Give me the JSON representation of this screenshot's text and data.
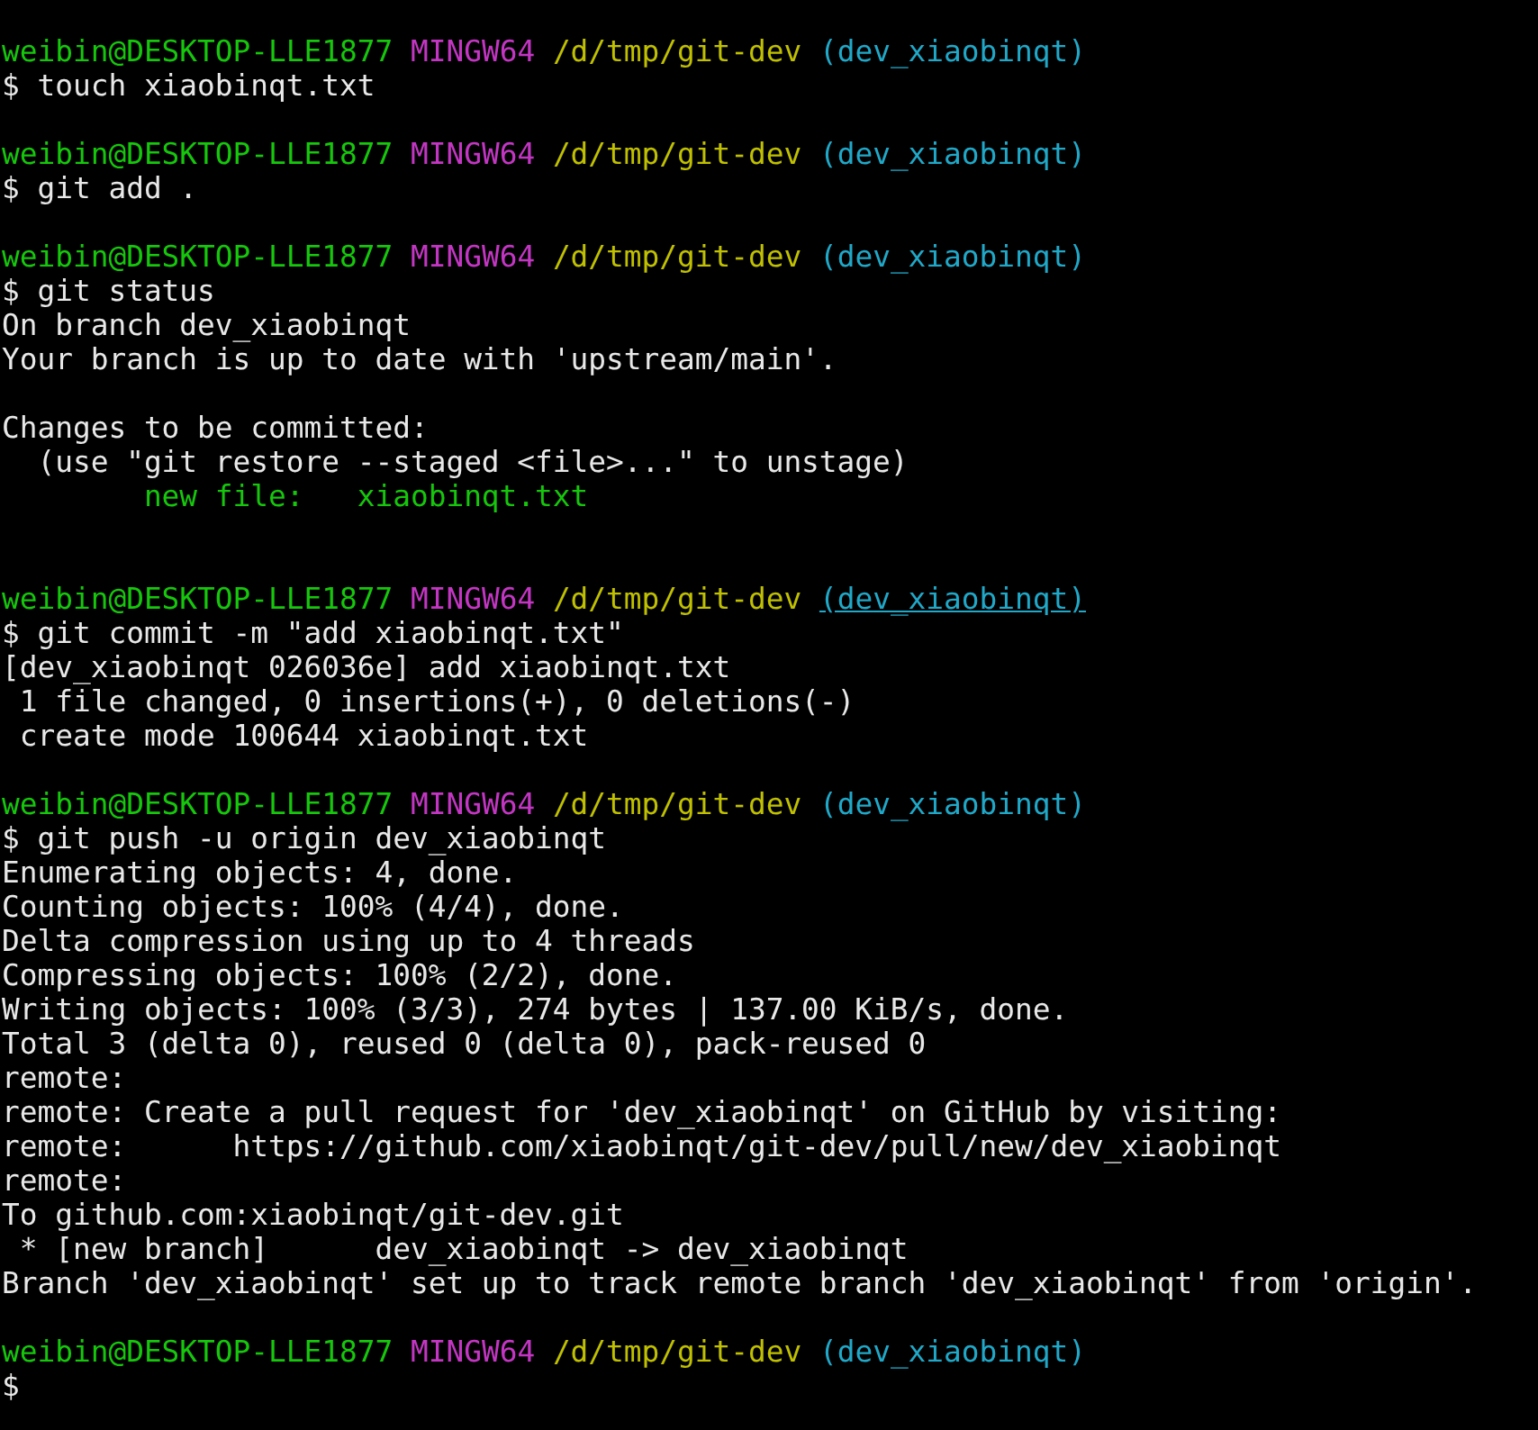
{
  "terminal": {
    "lines": [
      {
        "kind": "prompt",
        "user_host": "weibin@DESKTOP-LLE1877",
        "system": "MINGW64",
        "path": "/d/tmp/git-dev",
        "branch": "(dev_xiaobinqt)",
        "branch_underlined": false
      },
      {
        "kind": "output",
        "text": "$ touch xiaobinqt.txt"
      },
      {
        "kind": "blank"
      },
      {
        "kind": "prompt",
        "user_host": "weibin@DESKTOP-LLE1877",
        "system": "MINGW64",
        "path": "/d/tmp/git-dev",
        "branch": "(dev_xiaobinqt)",
        "branch_underlined": false
      },
      {
        "kind": "output",
        "text": "$ git add ."
      },
      {
        "kind": "blank"
      },
      {
        "kind": "prompt",
        "user_host": "weibin@DESKTOP-LLE1877",
        "system": "MINGW64",
        "path": "/d/tmp/git-dev",
        "branch": "(dev_xiaobinqt)",
        "branch_underlined": false
      },
      {
        "kind": "output",
        "text": "$ git status"
      },
      {
        "kind": "output",
        "text": "On branch dev_xiaobinqt"
      },
      {
        "kind": "output",
        "text": "Your branch is up to date with 'upstream/main'."
      },
      {
        "kind": "blank"
      },
      {
        "kind": "output",
        "text": "Changes to be committed:"
      },
      {
        "kind": "output",
        "text": "  (use \"git restore --staged <file>...\" to unstage)"
      },
      {
        "kind": "staged",
        "text": "        new file:   xiaobinqt.txt"
      },
      {
        "kind": "blank"
      },
      {
        "kind": "blank"
      },
      {
        "kind": "prompt",
        "user_host": "weibin@DESKTOP-LLE1877",
        "system": "MINGW64",
        "path": "/d/tmp/git-dev",
        "branch": "(dev_xiaobinqt)",
        "branch_underlined": true
      },
      {
        "kind": "output",
        "text": "$ git commit -m \"add xiaobinqt.txt\""
      },
      {
        "kind": "output",
        "text": "[dev_xiaobinqt 026036e] add xiaobinqt.txt"
      },
      {
        "kind": "output",
        "text": " 1 file changed, 0 insertions(+), 0 deletions(-)"
      },
      {
        "kind": "output",
        "text": " create mode 100644 xiaobinqt.txt"
      },
      {
        "kind": "blank"
      },
      {
        "kind": "prompt",
        "user_host": "weibin@DESKTOP-LLE1877",
        "system": "MINGW64",
        "path": "/d/tmp/git-dev",
        "branch": "(dev_xiaobinqt)",
        "branch_underlined": false
      },
      {
        "kind": "output",
        "text": "$ git push -u origin dev_xiaobinqt"
      },
      {
        "kind": "output",
        "text": "Enumerating objects: 4, done."
      },
      {
        "kind": "output",
        "text": "Counting objects: 100% (4/4), done."
      },
      {
        "kind": "output",
        "text": "Delta compression using up to 4 threads"
      },
      {
        "kind": "output",
        "text": "Compressing objects: 100% (2/2), done."
      },
      {
        "kind": "output",
        "text": "Writing objects: 100% (3/3), 274 bytes | 137.00 KiB/s, done."
      },
      {
        "kind": "output",
        "text": "Total 3 (delta 0), reused 0 (delta 0), pack-reused 0"
      },
      {
        "kind": "output",
        "text": "remote:"
      },
      {
        "kind": "output",
        "text": "remote: Create a pull request for 'dev_xiaobinqt' on GitHub by visiting:"
      },
      {
        "kind": "output",
        "text": "remote:      https://github.com/xiaobinqt/git-dev/pull/new/dev_xiaobinqt"
      },
      {
        "kind": "output",
        "text": "remote:"
      },
      {
        "kind": "output",
        "text": "To github.com:xiaobinqt/git-dev.git"
      },
      {
        "kind": "output",
        "text": " * [new branch]      dev_xiaobinqt -> dev_xiaobinqt"
      },
      {
        "kind": "output",
        "text": "Branch 'dev_xiaobinqt' set up to track remote branch 'dev_xiaobinqt' from 'origin'."
      },
      {
        "kind": "blank"
      },
      {
        "kind": "prompt",
        "user_host": "weibin@DESKTOP-LLE1877",
        "system": "MINGW64",
        "path": "/d/tmp/git-dev",
        "branch": "(dev_xiaobinqt)",
        "branch_underlined": false
      },
      {
        "kind": "output",
        "text": "$"
      }
    ]
  }
}
